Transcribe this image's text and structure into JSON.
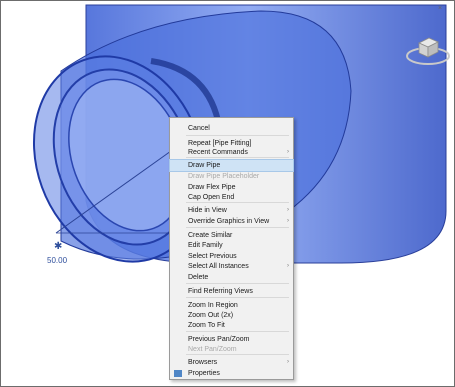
{
  "viewport": {
    "dimension_value": "50.00"
  },
  "context_menu": {
    "items": [
      {
        "label": "Cancel",
        "enabled": true,
        "submenu": false,
        "highlighted": false,
        "checked": false
      },
      {
        "label": "Repeat [Pipe Fitting]",
        "enabled": true,
        "submenu": false,
        "highlighted": false,
        "checked": false
      },
      {
        "label": "Recent Commands",
        "enabled": true,
        "submenu": true,
        "highlighted": false,
        "checked": false
      },
      {
        "label": "Draw Pipe",
        "enabled": true,
        "submenu": false,
        "highlighted": true,
        "checked": false
      },
      {
        "label": "Draw Pipe Placeholder",
        "enabled": false,
        "submenu": false,
        "highlighted": false,
        "checked": false
      },
      {
        "label": "Draw Flex Pipe",
        "enabled": true,
        "submenu": false,
        "highlighted": false,
        "checked": false
      },
      {
        "label": "Cap Open End",
        "enabled": true,
        "submenu": false,
        "highlighted": false,
        "checked": false
      },
      {
        "label": "Hide in View",
        "enabled": true,
        "submenu": true,
        "highlighted": false,
        "checked": false
      },
      {
        "label": "Override Graphics in View",
        "enabled": true,
        "submenu": true,
        "highlighted": false,
        "checked": false
      },
      {
        "label": "Create Similar",
        "enabled": true,
        "submenu": false,
        "highlighted": false,
        "checked": false
      },
      {
        "label": "Edit Family",
        "enabled": true,
        "submenu": false,
        "highlighted": false,
        "checked": false
      },
      {
        "label": "Select Previous",
        "enabled": true,
        "submenu": false,
        "highlighted": false,
        "checked": false
      },
      {
        "label": "Select All Instances",
        "enabled": true,
        "submenu": true,
        "highlighted": false,
        "checked": false
      },
      {
        "label": "Delete",
        "enabled": true,
        "submenu": false,
        "highlighted": false,
        "checked": false
      },
      {
        "label": "Find Referring Views",
        "enabled": true,
        "submenu": false,
        "highlighted": false,
        "checked": false
      },
      {
        "label": "Zoom In Region",
        "enabled": true,
        "submenu": false,
        "highlighted": false,
        "checked": false
      },
      {
        "label": "Zoom Out (2x)",
        "enabled": true,
        "submenu": false,
        "highlighted": false,
        "checked": false
      },
      {
        "label": "Zoom To Fit",
        "enabled": true,
        "submenu": false,
        "highlighted": false,
        "checked": false
      },
      {
        "label": "Previous Pan/Zoom",
        "enabled": true,
        "submenu": false,
        "highlighted": false,
        "checked": false
      },
      {
        "label": "Next Pan/Zoom",
        "enabled": false,
        "submenu": false,
        "highlighted": false,
        "checked": false
      },
      {
        "label": "Browsers",
        "enabled": true,
        "submenu": true,
        "highlighted": false,
        "checked": false
      },
      {
        "label": "Properties",
        "enabled": true,
        "submenu": false,
        "highlighted": false,
        "checked": true
      }
    ]
  },
  "colors": {
    "pipe_fill": "#6f8ee8",
    "pipe_dark": "#1f3aa6",
    "highlight": "#cfe3f5"
  }
}
